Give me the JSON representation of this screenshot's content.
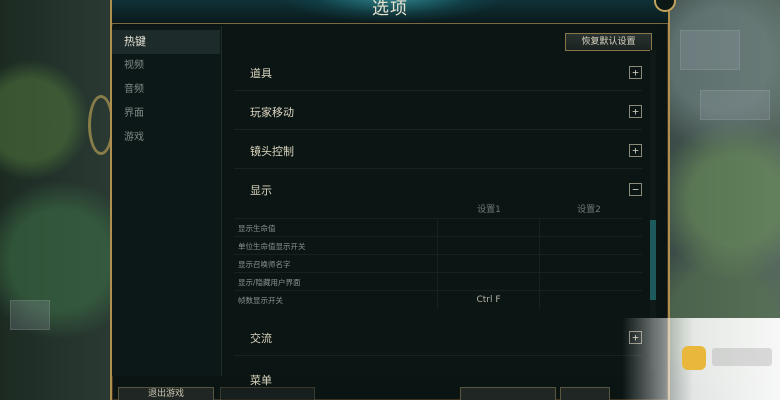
{
  "window": {
    "title": "选项"
  },
  "sidebar": {
    "items": [
      {
        "label": "热键",
        "active": true
      },
      {
        "label": "视频",
        "active": false
      },
      {
        "label": "音频",
        "active": false
      },
      {
        "label": "界面",
        "active": false
      },
      {
        "label": "游戏",
        "active": false
      }
    ]
  },
  "toolbar": {
    "reset_label": "恢复默认设置"
  },
  "sections": [
    {
      "label": "道具",
      "toggle": "+"
    },
    {
      "label": "玩家移动",
      "toggle": "+"
    },
    {
      "label": "镜头控制",
      "toggle": "+"
    },
    {
      "label": "显示",
      "toggle": "−"
    },
    {
      "label": "交流",
      "toggle": "+"
    },
    {
      "label": "菜单",
      "toggle": ""
    }
  ],
  "bindings": {
    "headers": [
      "设置1",
      "设置2"
    ],
    "rows": [
      {
        "label": "显示生命值",
        "set1": "",
        "set2": ""
      },
      {
        "label": "单位生命值显示开关",
        "set1": "",
        "set2": ""
      },
      {
        "label": "显示召唤师名字",
        "set1": "",
        "set2": ""
      },
      {
        "label": "显示/隐藏用户界面",
        "set1": "",
        "set2": ""
      },
      {
        "label": "帧数显示开关",
        "set1": "Ctrl F",
        "set2": ""
      }
    ]
  },
  "footer": {
    "buttons": [
      {
        "label": "退出游戏"
      },
      {
        "label": ""
      },
      {
        "label": ""
      },
      {
        "label": ""
      }
    ]
  },
  "colors": {
    "accent_gold": "#b18f4e",
    "panel": "#0b1514",
    "text_light": "#e6e4d6",
    "scroll_thumb": "#1e5a5c"
  }
}
